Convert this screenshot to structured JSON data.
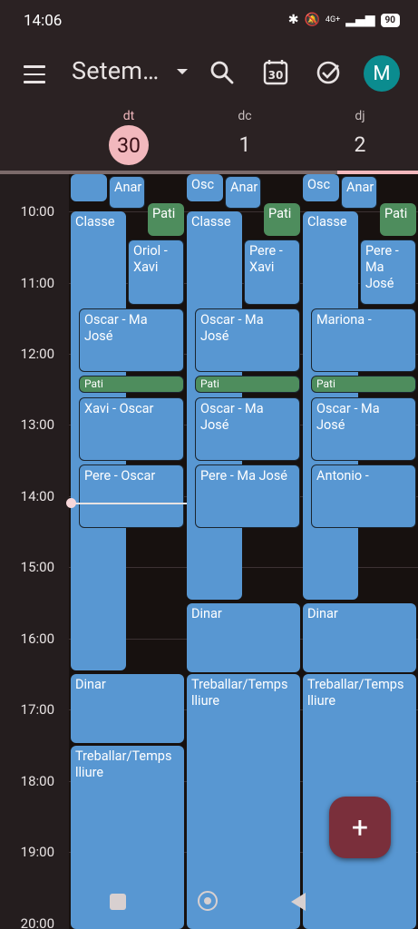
{
  "status_bar": {
    "time": "14:06",
    "battery": "90",
    "network": "4G+"
  },
  "app_bar": {
    "month_title": "Setem…",
    "avatar_letter": "M"
  },
  "days": [
    {
      "dow": "dt",
      "num": "30",
      "today": true
    },
    {
      "dow": "dc",
      "num": "1",
      "today": false
    },
    {
      "dow": "dj",
      "num": "2",
      "today": false
    }
  ],
  "hours": [
    "10:00",
    "11:00",
    "12:00",
    "13:00",
    "14:00",
    "15:00",
    "16:00",
    "17:00",
    "18:00",
    "19:00",
    "20:00"
  ],
  "events": {
    "col0": {
      "anar": "Anar",
      "pati_top": "Pati",
      "classe": "Classe",
      "oriol": "Oriol - Xavi",
      "oscar1": "Oscar - Ma José",
      "pati_mid": "Pati",
      "xavi": "Xavi - Oscar",
      "pere": "Pere - Oscar",
      "dinar": "Dinar",
      "treballar": "Treballar/Temps lliure"
    },
    "col1": {
      "osc": "Osc",
      "anar": "Anar",
      "pati_top": "Pati",
      "classe": "Classe",
      "pere_xavi": "Pere - Xavi",
      "oscar1": "Oscar - Ma José",
      "pati_mid": "Pati",
      "oscar2": "Oscar - Ma José",
      "pere_ma": "Pere - Ma José",
      "dinar": "Dinar",
      "treballar": "Treballar/Temps lliure"
    },
    "col2": {
      "osc": "Osc",
      "anar": "Anar",
      "pati_top": "Pati",
      "classe": "Classe",
      "pere_ma": "Pere - Ma José",
      "mariona": "Mariona -",
      "pati_mid": "Pati",
      "oscar": "Oscar - Ma José",
      "antonio": "Antonio -",
      "dinar": "Dinar",
      "treballar": "Treballar/Temps lliure"
    }
  },
  "fab_label": "+"
}
